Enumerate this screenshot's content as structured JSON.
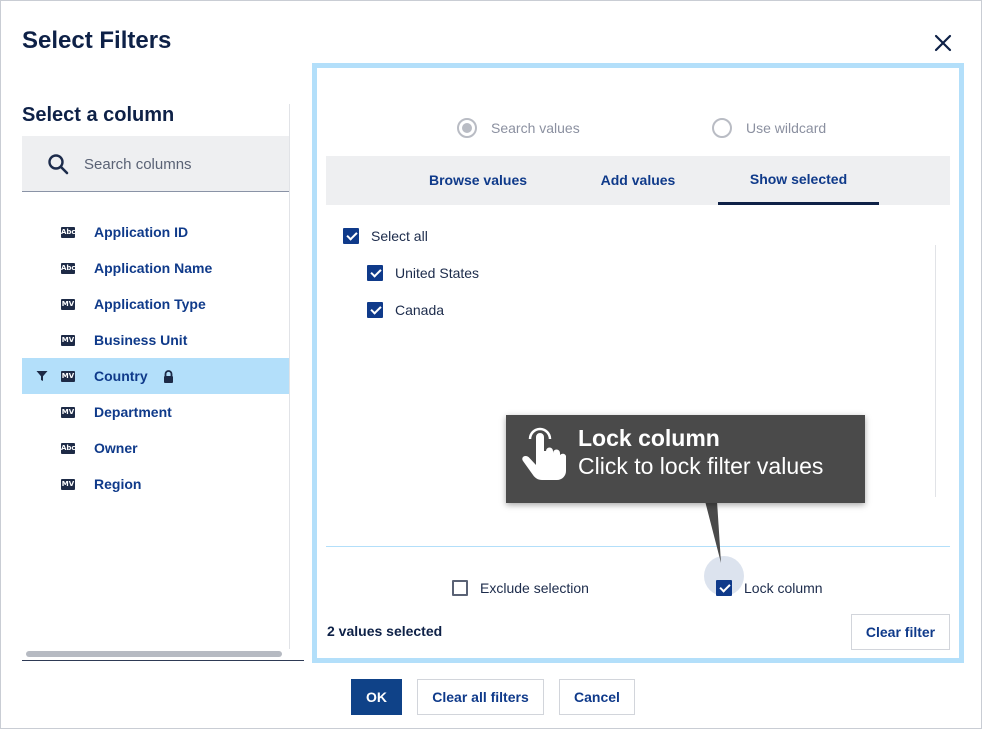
{
  "dialog": {
    "title": "Select Filters"
  },
  "left": {
    "title": "Select a column",
    "search_placeholder": "Search columns",
    "columns": [
      {
        "type": "Abc",
        "label": "Application ID",
        "filtered": false,
        "locked": false
      },
      {
        "type": "Abc",
        "label": "Application Name",
        "filtered": false,
        "locked": false
      },
      {
        "type": "MV",
        "label": "Application Type",
        "filtered": false,
        "locked": false
      },
      {
        "type": "MV",
        "label": "Business Unit",
        "filtered": false,
        "locked": false
      },
      {
        "type": "MV",
        "label": "Country",
        "filtered": true,
        "locked": true
      },
      {
        "type": "MV",
        "label": "Department",
        "filtered": false,
        "locked": false
      },
      {
        "type": "Abc",
        "label": "Owner",
        "filtered": false,
        "locked": false
      },
      {
        "type": "MV",
        "label": "Region",
        "filtered": false,
        "locked": false
      }
    ]
  },
  "right": {
    "radios": [
      {
        "label": "Search values",
        "selected": true
      },
      {
        "label": "Use wildcard",
        "selected": false
      }
    ],
    "tabs": [
      {
        "label": "Browse values",
        "active": false
      },
      {
        "label": "Add values",
        "active": false
      },
      {
        "label": "Show selected",
        "active": true
      }
    ],
    "select_all_label": "Select all",
    "values": [
      {
        "label": "United States",
        "checked": true
      },
      {
        "label": "Canada",
        "checked": true
      }
    ],
    "exclude_label": "Exclude selection",
    "lock_label": "Lock column",
    "count_text": "2 values selected",
    "clear_filter_label": "Clear filter"
  },
  "tooltip": {
    "title": "Lock column",
    "subtitle": "Click to lock filter values"
  },
  "footer": {
    "ok_label": "OK",
    "clear_all_label": "Clear all filters",
    "cancel_label": "Cancel"
  },
  "colors": {
    "primary": "#0f4288",
    "highlight": "#b3dffa",
    "link_text": "#0f3a8a",
    "tooltip_bg": "#4a4a4a"
  }
}
